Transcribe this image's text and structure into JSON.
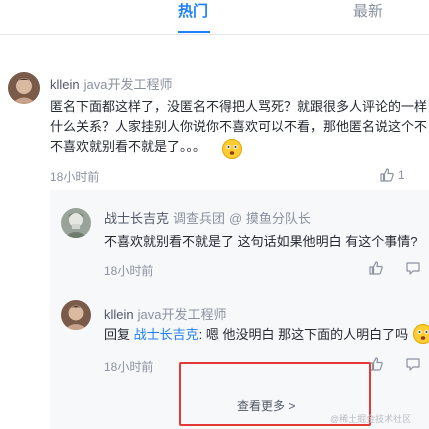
{
  "tabs": {
    "hot": "热门",
    "latest": "最新"
  },
  "comment1": {
    "user": "kllein",
    "job": "java开发工程师",
    "lines": [
      "匿名下面都这样了，没匿名不得把人骂死？就跟很多人评论的一样，",
      "什么关系？人家挂别人你说你不喜欢可以不看，那他匿名说这个不",
      "不喜欢就别看不就是了。。。"
    ],
    "time": "18小时前",
    "likes": "1"
  },
  "reply1": {
    "user": "战士长吉克",
    "job": "调查兵团",
    "circle": "@ 摸鱼分队长",
    "text": "不喜欢就别看不就是了 这句话如果他明白 有这个事情?",
    "time": "18小时前"
  },
  "reply2": {
    "user": "kllein",
    "job": "java开发工程师",
    "prefix": "回复 ",
    "mention": "战士长吉克",
    "text": ": 嗯 他没明白 那这下面的人明白了吗",
    "time": "18小时前"
  },
  "more_label": "查看更多 >",
  "watermark": "@稀土掘金技术社区",
  "colors": {
    "accent": "#1e80ff",
    "highlight": "#e53935"
  }
}
